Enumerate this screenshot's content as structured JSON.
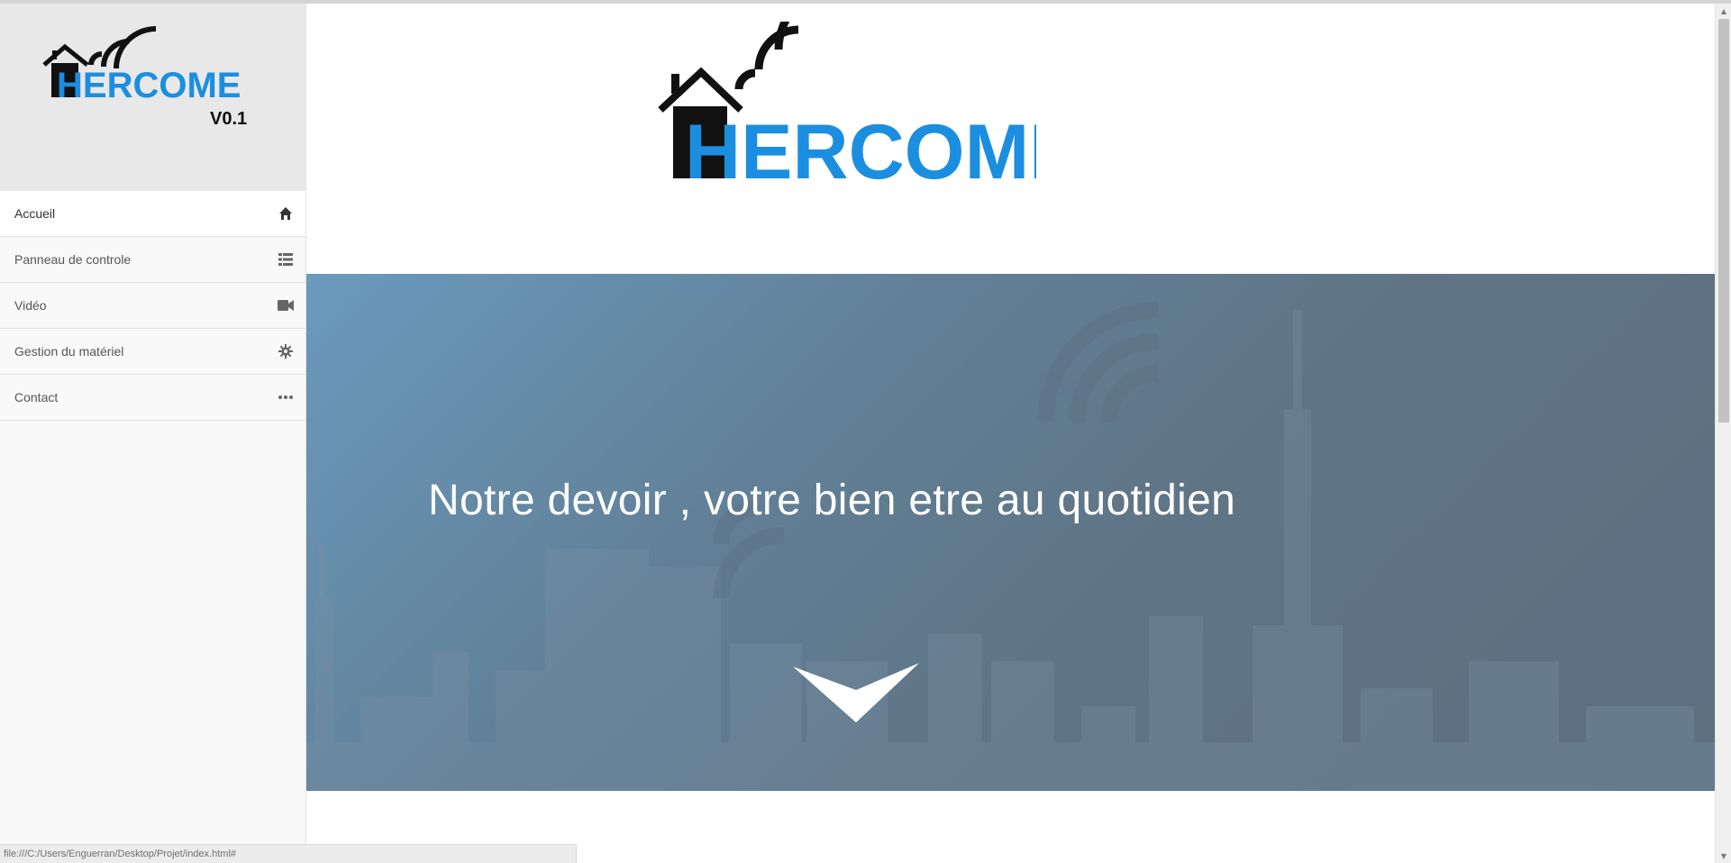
{
  "sidebar": {
    "logo_text": "HERCOME",
    "logo_version": "V0.1",
    "items": [
      {
        "label": "Accueil",
        "icon": "home-icon"
      },
      {
        "label": "Panneau de controle",
        "icon": "list-icon"
      },
      {
        "label": "Vidéo",
        "icon": "video-camera-icon"
      },
      {
        "label": "Gestion du matériel",
        "icon": "gear-icon"
      },
      {
        "label": "Contact",
        "icon": "more-icon"
      }
    ]
  },
  "header": {
    "logo_text": "HERCOME"
  },
  "hero": {
    "title": "Notre devoir , votre bien etre au quotidien"
  },
  "statusbar": {
    "url": "file:///C:/Users/Enguerran/Desktop/Projet/index.html#"
  },
  "colors": {
    "brand_blue": "#1b8ee0",
    "logo_black": "#111111",
    "hero_start": "#6a9abd",
    "hero_end": "#5c6f80"
  }
}
